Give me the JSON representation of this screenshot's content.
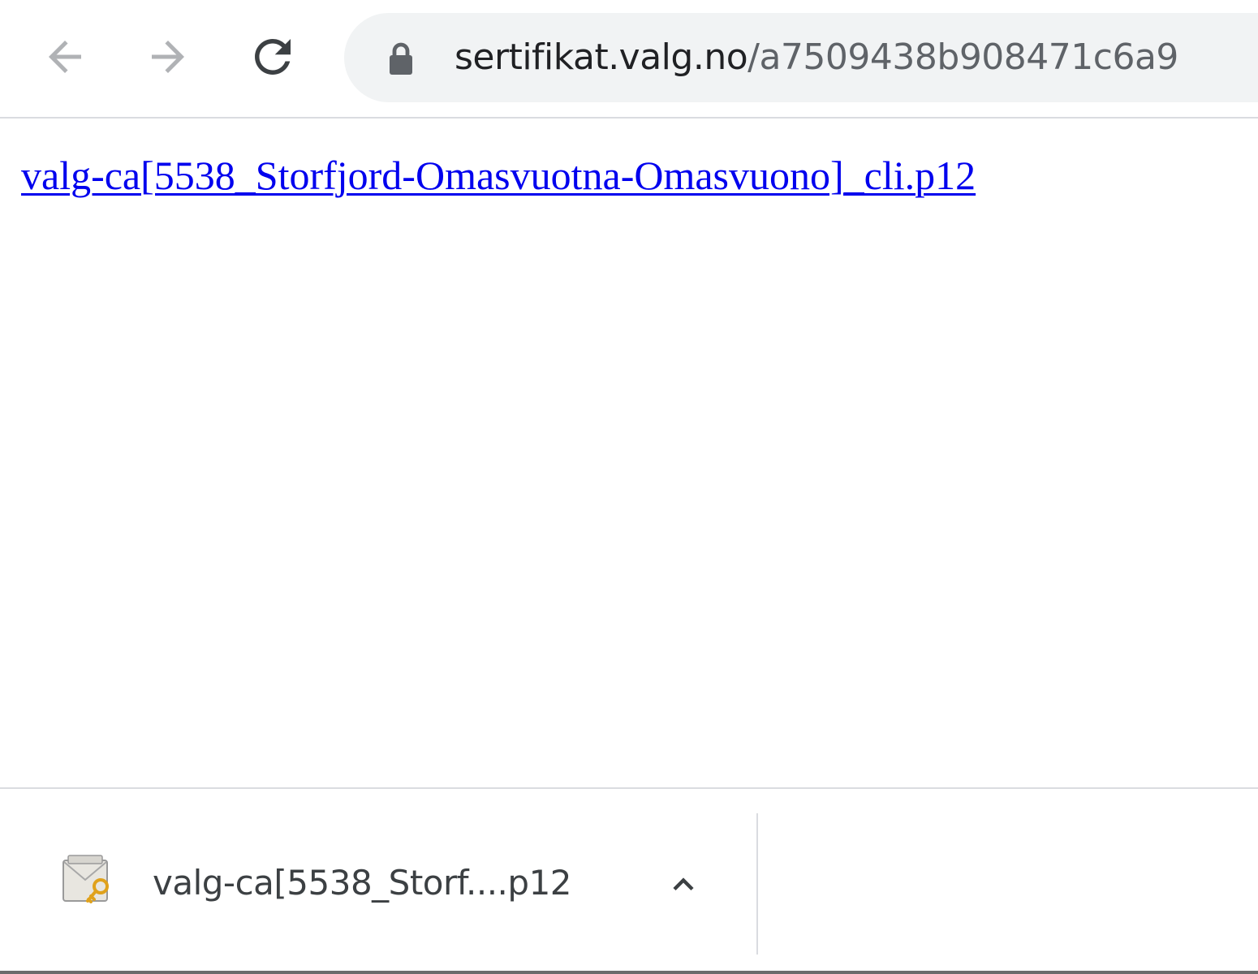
{
  "toolbar": {
    "url_host": "sertifikat.valg.no",
    "url_path": "/a7509438b908471c6a9"
  },
  "page": {
    "link_text": "valg-ca[5538_Storfjord-Omasvuotna-Omasvuono]_cli.p12"
  },
  "download_shelf": {
    "item_name": "valg-ca[5538_Storf....p12"
  },
  "colors": {
    "link": "#0000ee",
    "omnibox_bg": "#f1f3f4",
    "divider": "#dadce0"
  }
}
